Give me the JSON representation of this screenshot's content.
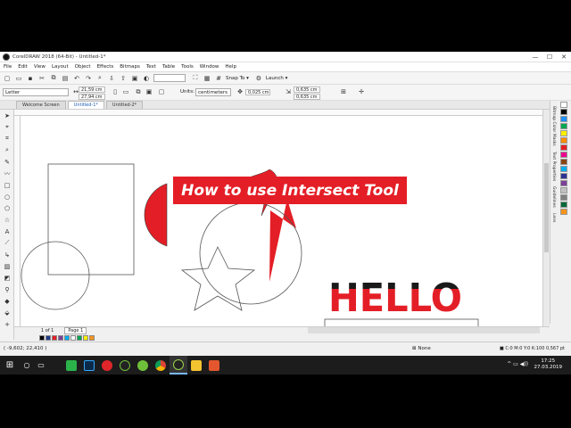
{
  "window": {
    "title": "CorelDRAW 2018 (64-Bit) - Untitled-1*",
    "minimize": "—",
    "maximize": "☐",
    "close": "✕"
  },
  "menu": [
    "File",
    "Edit",
    "View",
    "Layout",
    "Object",
    "Effects",
    "Bitmaps",
    "Text",
    "Table",
    "Tools",
    "Window",
    "Help"
  ],
  "toolbar": {
    "snap_to": "Snap To",
    "launch": "Launch"
  },
  "property_bar": {
    "page_size": "Letter",
    "width": "21,59 cm",
    "height": "27,94 cm",
    "units_label": "Units:",
    "units_value": "centimeters",
    "nudge": "0,025 cm",
    "dup_x": "0,635 cm",
    "dup_y": "0,635 cm"
  },
  "doc_tabs": [
    "Welcome Screen",
    "Untitled-1*",
    "Untitled-2*"
  ],
  "dockers": [
    "Bitmap Color Masks",
    "Text Properties",
    "Guidelines",
    "Lens"
  ],
  "page_nav": {
    "position": "1 of 1",
    "page_tab": "Page 1"
  },
  "status": {
    "coords": "( -9,602; 22,410 )",
    "fill": "None",
    "color_info": "C:0 M:0 Y:0 K:100  0,567 pt"
  },
  "clock": {
    "time": "17:25",
    "date": "27.03.2019"
  },
  "canvas": {
    "banner_text": "How to use Intersect Tool",
    "hello_text": "HELLO"
  },
  "colors": {
    "accent_red": "#e41e26",
    "black": "#1a1a1a"
  },
  "palette": [
    "#ffffff",
    "#000000",
    "#1e90ff",
    "#00a651",
    "#ffef00",
    "#ff8c00",
    "#e41e26",
    "#ec008c",
    "#8b4513",
    "#00aeef",
    "#2e3192",
    "#7f3f98",
    "#c0c0c0",
    "#808080",
    "#006838",
    "#f7941d"
  ],
  "doc_palette": [
    "#000000",
    "#1e3a8a",
    "#e41e26",
    "#7f3f98",
    "#00aeef",
    "#ffffff",
    "#00a651",
    "#ffef00",
    "#f7941d"
  ],
  "taskbar_apps": [
    "camtasia-icon",
    "photoshop-icon",
    "app-red-icon",
    "coreldraw-icon",
    "app-green-icon",
    "chrome-icon",
    "coreldraw-icon",
    "file-explorer-icon",
    "camtasia-icon"
  ]
}
